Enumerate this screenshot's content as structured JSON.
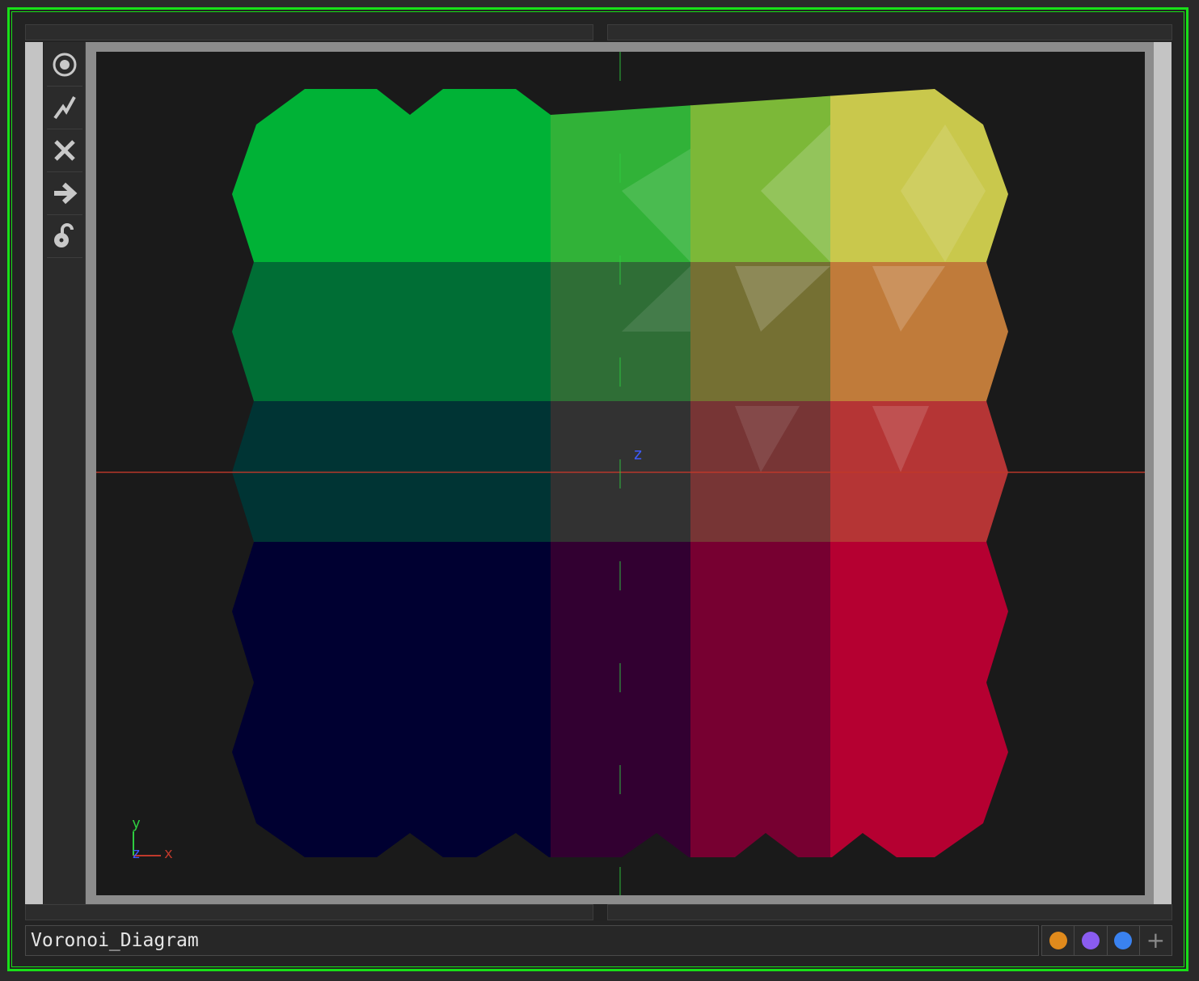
{
  "node": {
    "name": "Voronoi_Diagram"
  },
  "toolbar": {
    "buttons": [
      {
        "icon": "target-icon"
      },
      {
        "icon": "lightning-icon"
      },
      {
        "icon": "close-icon"
      },
      {
        "icon": "arrow-right-icon"
      },
      {
        "icon": "unlock-icon"
      }
    ]
  },
  "viewer": {
    "axis_labels": {
      "z_center": "z",
      "gizmo_y": "y",
      "gizmo_z": "z",
      "gizmo_x": "x"
    },
    "grid": {
      "cols": 5,
      "rows": 6
    },
    "cell_colors": [
      [
        "#00b236",
        "#00b236",
        "#31b238",
        "#7cb838",
        "#c9c84c"
      ],
      [
        "#006e35",
        "#006e35",
        "#2f6e36",
        "#757033",
        "#c07b3a"
      ],
      [
        "#003434",
        "#003434",
        "#323232",
        "#773535",
        "#b53535"
      ],
      [
        "#000031",
        "#000031",
        "#320031",
        "#770031",
        "#b50031"
      ],
      [
        "#000031",
        "#000031",
        "#320031",
        "#770031",
        "#b50031"
      ]
    ]
  },
  "colors": {
    "frame": "#18e018",
    "axis_x": "#c0392b",
    "axis_y": "#2ecc40",
    "axis_z": "#3d5afe"
  },
  "swatches": [
    {
      "color": "#e08a1c"
    },
    {
      "color": "#8a5cf0"
    },
    {
      "color": "#3a82f0"
    },
    {
      "icon": "plus-icon"
    }
  ]
}
